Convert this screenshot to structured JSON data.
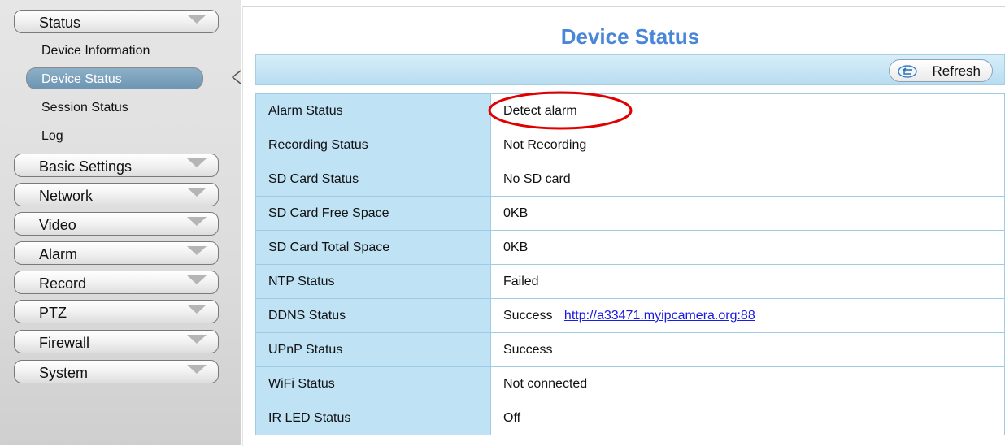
{
  "sidebar": {
    "status_label": "Status",
    "status_subitems": [
      "Device Information",
      "Device Status",
      "Session Status",
      "Log"
    ],
    "menus": [
      "Basic Settings",
      "Network",
      "Video",
      "Alarm",
      "Record",
      "PTZ",
      "Firewall",
      "System"
    ]
  },
  "main": {
    "title": "Device Status",
    "refresh_label": "Refresh",
    "rows": [
      {
        "label": "Alarm Status",
        "value": "Detect alarm"
      },
      {
        "label": "Recording Status",
        "value": "Not Recording"
      },
      {
        "label": "SD Card Status",
        "value": "No SD card"
      },
      {
        "label": "SD Card Free Space",
        "value": "0KB"
      },
      {
        "label": "SD Card Total Space",
        "value": "0KB"
      },
      {
        "label": "NTP Status",
        "value": "Failed"
      },
      {
        "label": "DDNS Status",
        "value": "Success",
        "link": "http://a33471.myipcamera.org:88"
      },
      {
        "label": "UPnP Status",
        "value": "Success"
      },
      {
        "label": "WiFi Status",
        "value": "Not connected"
      },
      {
        "label": "IR LED Status",
        "value": "Off"
      }
    ]
  },
  "colors": {
    "title": "#4a86d8",
    "annotation": "#e00000",
    "label_cell": "#bfe2f5",
    "selected_item": "#7a9fba"
  }
}
